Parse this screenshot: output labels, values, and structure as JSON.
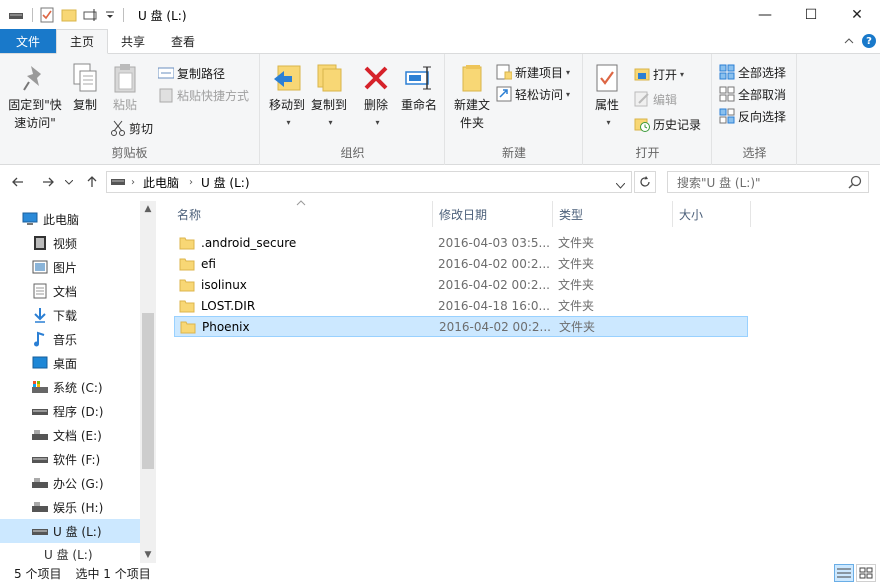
{
  "window": {
    "title": "U 盘 (L:)",
    "minimize": "—",
    "maximize": "☐",
    "close": "✕"
  },
  "tabs": {
    "file": "文件",
    "home": "主页",
    "share": "共享",
    "view": "查看"
  },
  "ribbon": {
    "clipboard": {
      "label": "剪贴板",
      "pin": "固定到\"快速访问\"",
      "copy": "复制",
      "paste": "粘贴",
      "copy_path": "复制路径",
      "paste_shortcut": "粘贴快捷方式",
      "cut": "剪切"
    },
    "organize": {
      "label": "组织",
      "move_to": "移动到",
      "copy_to": "复制到",
      "delete": "删除",
      "rename": "重命名"
    },
    "new": {
      "label": "新建",
      "new_folder": "新建文件夹",
      "new_item": "新建项目",
      "easy_access": "轻松访问"
    },
    "open": {
      "label": "打开",
      "properties": "属性",
      "open": "打开",
      "edit": "编辑",
      "history": "历史记录"
    },
    "select": {
      "label": "选择",
      "select_all": "全部选择",
      "select_none": "全部取消",
      "invert": "反向选择"
    }
  },
  "address": {
    "this_pc": "此电脑",
    "drive": "U 盘 (L:)",
    "search_placeholder": "搜索\"U 盘 (L:)\""
  },
  "nav": {
    "items": [
      {
        "label": "此电脑"
      },
      {
        "label": "视频"
      },
      {
        "label": "图片"
      },
      {
        "label": "文档"
      },
      {
        "label": "下载"
      },
      {
        "label": "音乐"
      },
      {
        "label": "桌面"
      },
      {
        "label": "系统 (C:)"
      },
      {
        "label": "程序 (D:)"
      },
      {
        "label": "文档 (E:)"
      },
      {
        "label": "软件 (F:)"
      },
      {
        "label": "办公 (G:)"
      },
      {
        "label": "娱乐 (H:)"
      },
      {
        "label": "U 盘 (L:)"
      },
      {
        "label": "U 盘 (L:)"
      }
    ]
  },
  "columns": {
    "name": "名称",
    "date": "修改日期",
    "type": "类型",
    "size": "大小"
  },
  "files": [
    {
      "name": ".android_secure",
      "date": "2016-04-03 03:5...",
      "type": "文件夹"
    },
    {
      "name": "efi",
      "date": "2016-04-02 00:2...",
      "type": "文件夹"
    },
    {
      "name": "isolinux",
      "date": "2016-04-02 00:2...",
      "type": "文件夹"
    },
    {
      "name": "LOST.DIR",
      "date": "2016-04-18 16:0...",
      "type": "文件夹"
    },
    {
      "name": "Phoenix",
      "date": "2016-04-02 00:2...",
      "type": "文件夹"
    }
  ],
  "status": {
    "count": "5 个项目",
    "selected": "选中 1 个项目"
  },
  "colors": {
    "accent": "#1979ca",
    "selection": "#cce8ff",
    "folder": "#f8d775"
  }
}
